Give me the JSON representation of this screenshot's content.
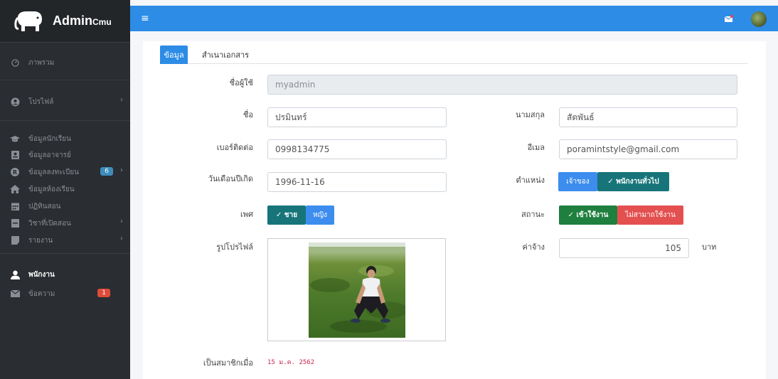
{
  "brand": {
    "name": "Admin",
    "suffix": "Cmu"
  },
  "sidebar": {
    "items": [
      {
        "label": "ภาพรวม",
        "icon": "dashboard-icon"
      },
      {
        "label": "โปรไฟล์",
        "icon": "user-circle-icon"
      },
      {
        "label": "ข้อมูลนักเรียน",
        "icon": "graduation-cap-icon"
      },
      {
        "label": "ข้อมูลอาจารย์",
        "icon": "id-card-icon"
      },
      {
        "label": "ข้อมูลลงทะเบียน",
        "icon": "registered-icon",
        "badge": "6"
      },
      {
        "label": "ข้อมูลห้องเรียน",
        "icon": "home-icon"
      },
      {
        "label": "ปฏิทินสอน",
        "icon": "calendar-icon"
      },
      {
        "label": "วิชาที่เปิดสอน",
        "icon": "book-icon"
      },
      {
        "label": "รายงาน",
        "icon": "file-icon"
      },
      {
        "label": "พนักงาน",
        "icon": "user-icon"
      },
      {
        "label": "ข้อความ",
        "icon": "envelope-icon",
        "badge": "1"
      }
    ]
  },
  "tabs": [
    {
      "label": "ข้อมูล"
    },
    {
      "label": "สำเนาเอกสาร"
    }
  ],
  "form": {
    "username": {
      "label": "ชื่อผู้ใช้",
      "value": "myadmin"
    },
    "firstname": {
      "label": "ชื่อ",
      "value": "ปรมินทร์"
    },
    "lastname": {
      "label": "นามสกุล",
      "value": "สัตพันธ์"
    },
    "phone": {
      "label": "เบอร์ติดต่อ",
      "value": "0998134775"
    },
    "email": {
      "label": "อีเมล",
      "value": "poramintstyle@gmail.com"
    },
    "birthdate": {
      "label": "วันเดือนปีเกิด",
      "value": "1996-11-16"
    },
    "position": {
      "label": "ตำแหน่ง",
      "owner": "เจ้าของ",
      "staff": "✓ พนักงานทั่วไป"
    },
    "gender": {
      "label": "เพศ",
      "male": "✓ ชาย",
      "female": "หญิง"
    },
    "status": {
      "label": "สถานะ",
      "active": "✓ เข้าใช้งาน",
      "inactive": "ไม่สามาถใช้งาน"
    },
    "photo": {
      "label": "รูปโปรไฟล์"
    },
    "wage": {
      "label": "ค่าจ้าง",
      "value": "105",
      "unit": "บาท"
    },
    "member_since": {
      "label": "เป็นสมาชิกเมื่อ",
      "value": "15 ม.ค. 2562"
    }
  },
  "colors": {
    "primary": "#2d8ce6",
    "sidebar": "#2a2d31",
    "teal": "#17757a",
    "green": "#1f7f3f",
    "red": "#e45050"
  }
}
